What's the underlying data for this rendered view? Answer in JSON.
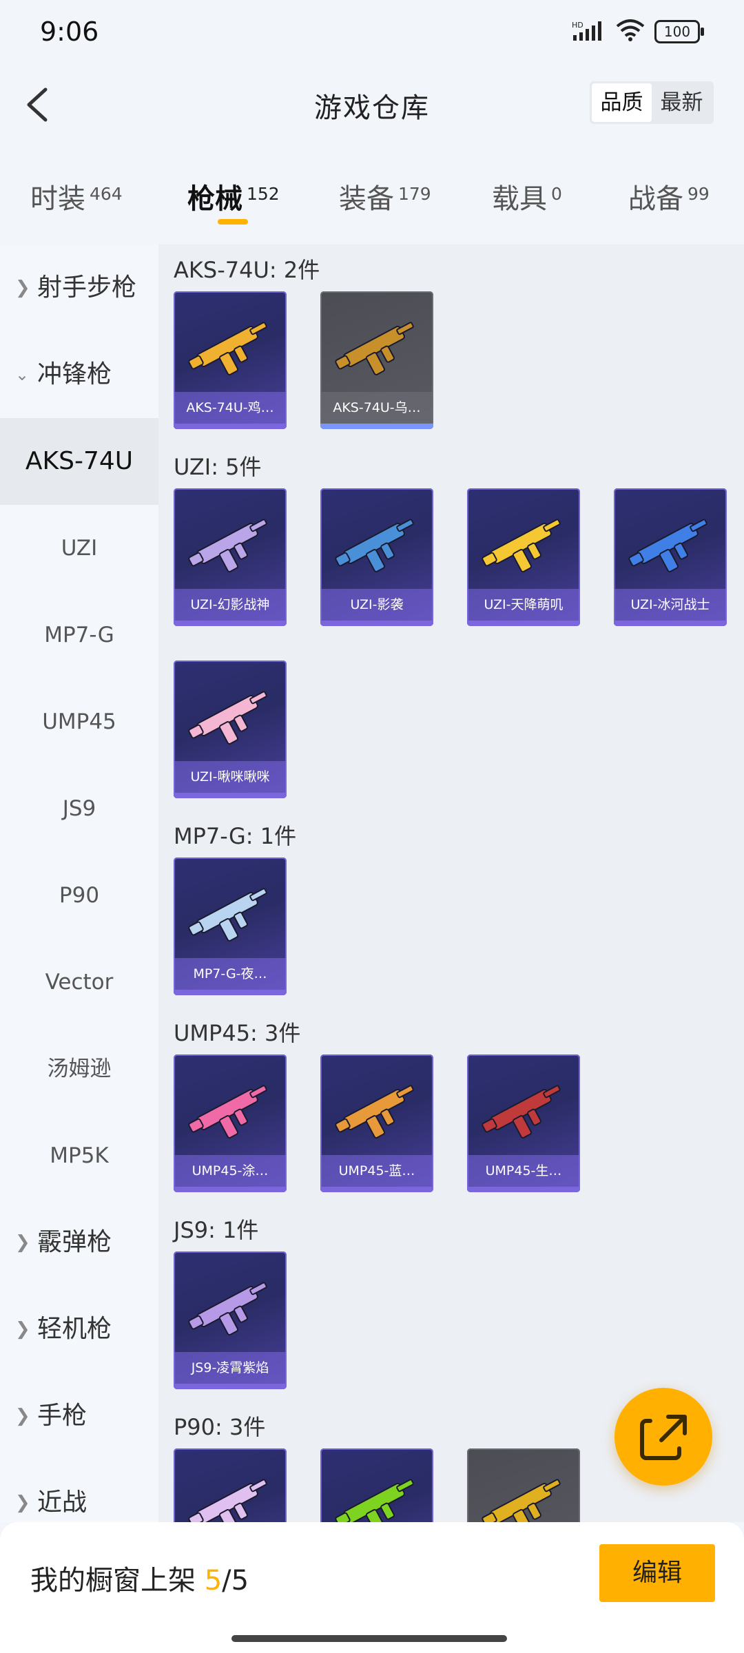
{
  "status": {
    "time": "9:06",
    "battery": "100",
    "network": "HD"
  },
  "header": {
    "title": "游戏仓库",
    "sort_options": [
      "品质",
      "最新"
    ],
    "sort_active": "品质"
  },
  "tabs": [
    {
      "label": "时装",
      "count": "464"
    },
    {
      "label": "枪械",
      "count": "152"
    },
    {
      "label": "装备",
      "count": "179"
    },
    {
      "label": "载具",
      "count": "0"
    },
    {
      "label": "战备",
      "count": "99"
    }
  ],
  "active_tab": "枪械",
  "sidebar": {
    "groups_top": [
      {
        "label": "射手步枪"
      },
      {
        "label": "冲锋枪"
      }
    ],
    "subs": [
      "AKS-74U",
      "UZI",
      "MP7-G",
      "UMP45",
      "JS9",
      "P90",
      "Vector",
      "汤姆逊",
      "MP5K"
    ],
    "active_sub": "AKS-74U",
    "groups_bottom": [
      {
        "label": "霰弹枪"
      },
      {
        "label": "轻机枪"
      },
      {
        "label": "手枪"
      },
      {
        "label": "近战"
      }
    ]
  },
  "sections": [
    {
      "title": "AKS-74U: 2件",
      "items": [
        {
          "name": "AKS-74U-鸡…",
          "quality": "purple",
          "color": "#f0b030"
        },
        {
          "name": "AKS-74U-乌…",
          "quality": "gray",
          "color": "#c8902a"
        }
      ]
    },
    {
      "title": "UZI: 5件",
      "items": [
        {
          "name": "UZI-幻影战神",
          "quality": "purple",
          "color": "#b9a5e8"
        },
        {
          "name": "UZI-影袭",
          "quality": "purple",
          "color": "#4a90d9"
        },
        {
          "name": "UZI-天降萌叽",
          "quality": "purple",
          "color": "#f5c833"
        },
        {
          "name": "UZI-冰河战士",
          "quality": "purple",
          "color": "#3f7fe6"
        },
        {
          "name": "UZI-啾咪啾咪",
          "quality": "purple",
          "color": "#f4b6d2"
        }
      ]
    },
    {
      "title": "MP7-G: 1件",
      "items": [
        {
          "name": "MP7-G-夜…",
          "quality": "purple",
          "color": "#b8d4f0"
        }
      ]
    },
    {
      "title": "UMP45: 3件",
      "items": [
        {
          "name": "UMP45-涂…",
          "quality": "purple",
          "color": "#f06aa8"
        },
        {
          "name": "UMP45-蓝…",
          "quality": "purple",
          "color": "#e89a3a"
        },
        {
          "name": "UMP45-生…",
          "quality": "purple",
          "color": "#c0393b"
        }
      ]
    },
    {
      "title": "JS9: 1件",
      "items": [
        {
          "name": "JS9-凌霄紫焰",
          "quality": "purple",
          "color": "#b69ae8"
        }
      ]
    },
    {
      "title": "P90: 3件",
      "items": [
        {
          "name": "",
          "quality": "purple",
          "color": "#e0c0f0"
        },
        {
          "name": "",
          "quality": "purple",
          "color": "#7ed321"
        },
        {
          "name": "",
          "quality": "gray",
          "color": "#e0b020"
        }
      ]
    }
  ],
  "bottom": {
    "label": "我的橱窗上架",
    "current": "5",
    "total": "/5",
    "edit_label": "编辑"
  },
  "colors": {
    "accent": "#ffb000",
    "card_purple": "#2d2f72",
    "card_gray": "#4c4d54"
  }
}
